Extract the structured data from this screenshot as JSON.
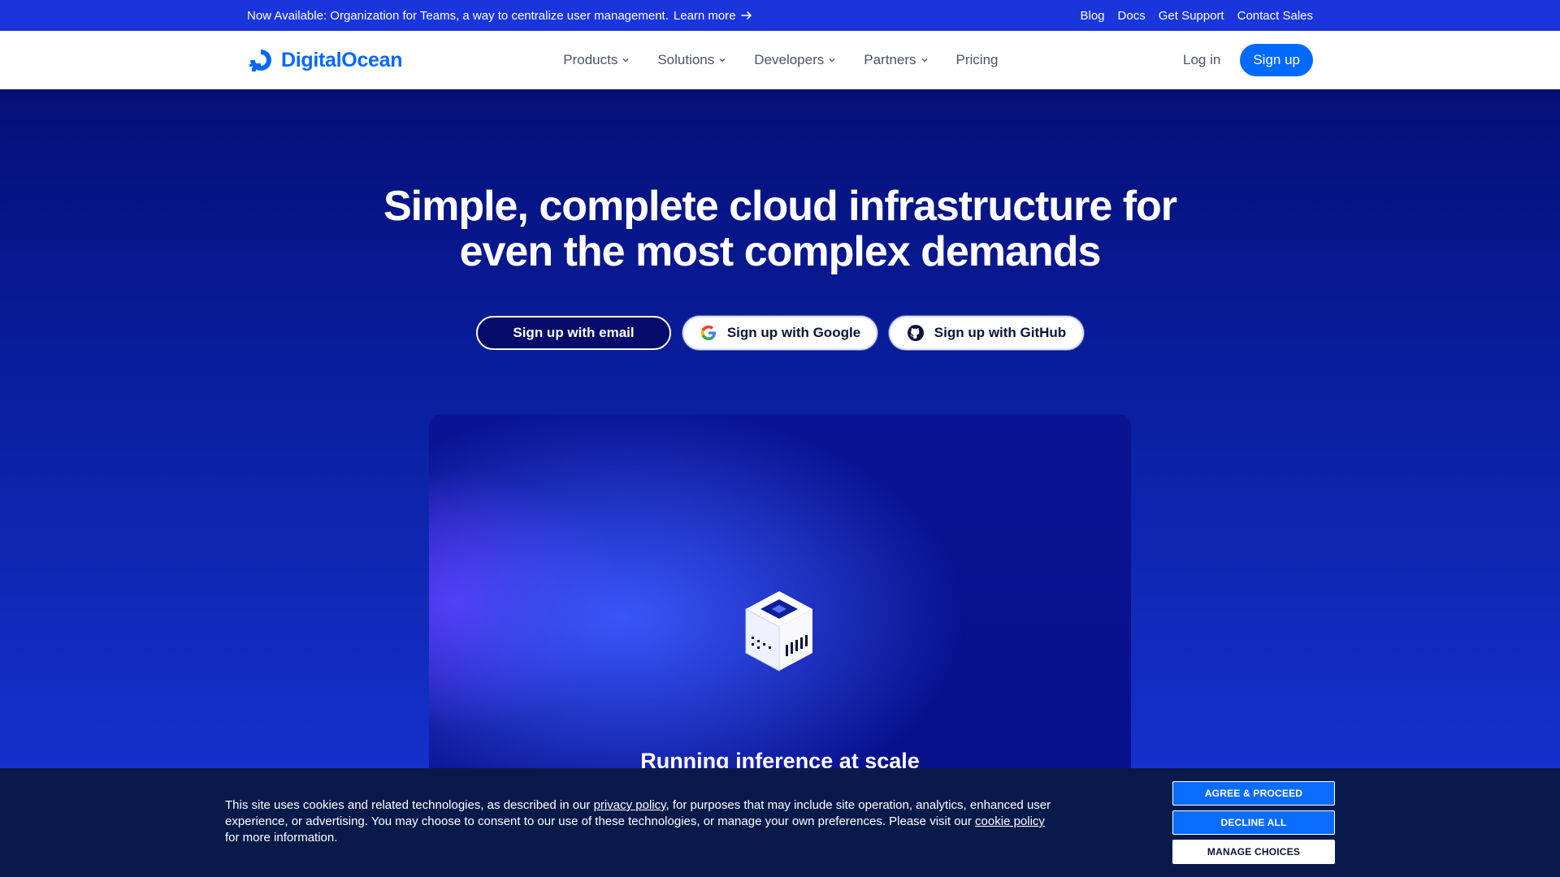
{
  "announcement": {
    "text": "Now Available: Organization for Teams, a way to centralize user management.",
    "link": "Learn more",
    "arrow_icon": "arrow-right-icon"
  },
  "top_links": [
    "Blog",
    "Docs",
    "Get Support",
    "Contact Sales"
  ],
  "brand": {
    "name": "DigitalOcean",
    "color": "#0069ff"
  },
  "nav": {
    "items": [
      {
        "label": "Products",
        "dropdown": true
      },
      {
        "label": "Solutions",
        "dropdown": true
      },
      {
        "label": "Developers",
        "dropdown": true
      },
      {
        "label": "Partners",
        "dropdown": true
      },
      {
        "label": "Pricing",
        "dropdown": false
      }
    ],
    "login": "Log in",
    "signup": "Sign up"
  },
  "hero": {
    "title_line1": "Simple, complete cloud infrastructure for",
    "title_line2": "even the most complex demands",
    "cta_email": "Sign up with email",
    "cta_google": "Sign up with Google",
    "cta_github": "Sign up with GitHub"
  },
  "card": {
    "caption": "Running inference at scale",
    "icon": "server-cube-icon"
  },
  "cookie": {
    "text_before_privacy": "This site uses cookies and related technologies, as described in our ",
    "privacy_link": "privacy policy",
    "text_middle": ", for purposes that may include site operation, analytics, enhanced user experience, or advertising. You may choose to consent to our use of these technologies, or manage your own preferences. Please visit our ",
    "cookie_link": "cookie policy",
    "text_after": " for more information.",
    "agree": "AGREE & PROCEED",
    "decline": "DECLINE ALL",
    "manage": "MANAGE CHOICES"
  },
  "colors": {
    "announcement_bg": "#1a35dc",
    "accent": "#0069ff",
    "cookie_bg": "#081a4a"
  }
}
